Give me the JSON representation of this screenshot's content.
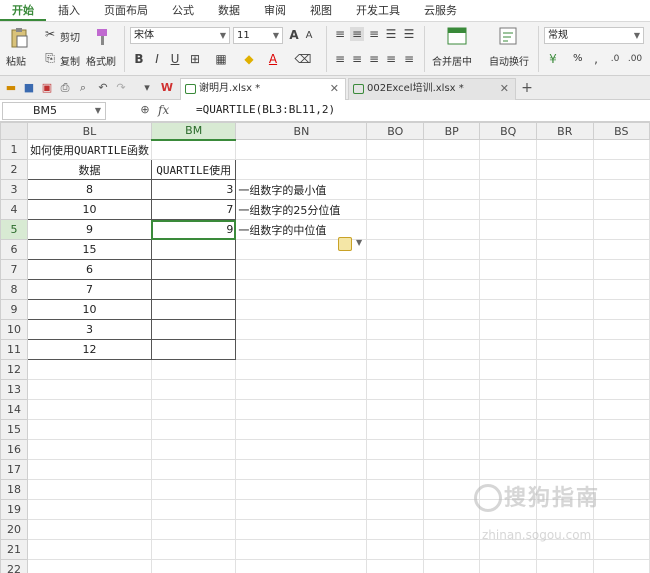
{
  "menu": [
    "开始",
    "插入",
    "页面布局",
    "公式",
    "数据",
    "审阅",
    "视图",
    "开发工具",
    "云服务"
  ],
  "ribbon": {
    "paste": "粘贴",
    "cut": "剪切",
    "copy": "复制",
    "format_painter": "格式刷",
    "font_name": "宋体",
    "font_size": "11",
    "merge_center": "合并居中",
    "wrap_text": "自动换行",
    "number_format": "常规",
    "percent": "%"
  },
  "tabs": [
    {
      "title": "谢明月.xlsx *",
      "active": true
    },
    {
      "title": "002Excel培训.xlsx *",
      "active": false
    }
  ],
  "formula_bar": {
    "name_box": "BM5",
    "fx": "fx",
    "formula": "=QUARTILE(BL3:BL11,2)"
  },
  "columns": [
    "BL",
    "BM",
    "BN",
    "BO",
    "BP",
    "BQ",
    "BR",
    "BS"
  ],
  "selected_column": "BM",
  "selected_row": 5,
  "sheet": {
    "title": "如何使用QUARTILE函数",
    "header_data": "数据",
    "header_usage": "QUARTILE使用",
    "data": [
      "8",
      "10",
      "9",
      "15",
      "6",
      "7",
      "10",
      "3",
      "12"
    ],
    "results": [
      "3",
      "7",
      "9"
    ],
    "notes": [
      "一组数字的最小值",
      "一组数字的25分位值",
      "一组数字的中位值"
    ]
  },
  "row_count": 22,
  "watermark": {
    "text": "搜狗指南",
    "sub": "zhinan.sogou.com"
  },
  "colors": {
    "accent": "#3a8a3a"
  }
}
